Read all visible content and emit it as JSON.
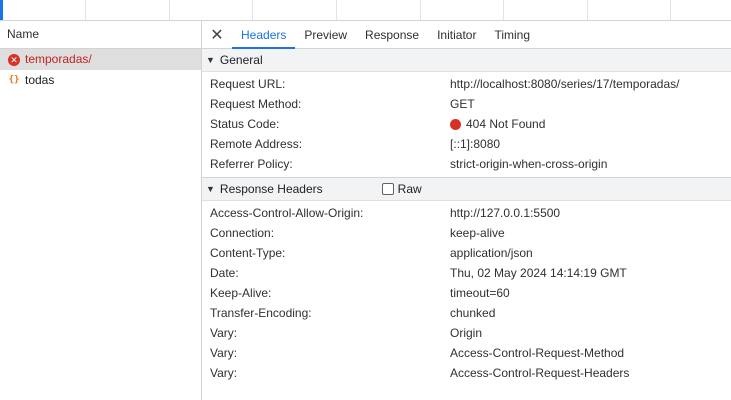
{
  "timeline": {
    "accent_color": "#1a73e8"
  },
  "network": {
    "name_column_label": "Name",
    "requests": [
      {
        "name": "temporadas/",
        "status": "error",
        "icon": "error-circle-icon"
      },
      {
        "name": "todas",
        "status": "ok",
        "icon": "json-braces-icon"
      }
    ]
  },
  "details": {
    "close_label": "✕",
    "tabs": [
      {
        "label": "Headers",
        "active": true
      },
      {
        "label": "Preview",
        "active": false
      },
      {
        "label": "Response",
        "active": false
      },
      {
        "label": "Initiator",
        "active": false
      },
      {
        "label": "Timing",
        "active": false
      }
    ],
    "general": {
      "title": "General",
      "rows": [
        {
          "key": "Request URL:",
          "value": "http://localhost:8080/series/17/temporadas/"
        },
        {
          "key": "Request Method:",
          "value": "GET"
        },
        {
          "key": "Status Code:",
          "value": "404 Not Found",
          "status_color": "#d93025"
        },
        {
          "key": "Remote Address:",
          "value": "[::1]:8080"
        },
        {
          "key": "Referrer Policy:",
          "value": "strict-origin-when-cross-origin"
        }
      ]
    },
    "response_headers": {
      "title": "Response Headers",
      "raw_label": "Raw",
      "raw_checked": false,
      "rows": [
        {
          "key": "Access-Control-Allow-Origin:",
          "value": "http://127.0.0.1:5500"
        },
        {
          "key": "Connection:",
          "value": "keep-alive"
        },
        {
          "key": "Content-Type:",
          "value": "application/json"
        },
        {
          "key": "Date:",
          "value": "Thu, 02 May 2024 14:14:19 GMT"
        },
        {
          "key": "Keep-Alive:",
          "value": "timeout=60"
        },
        {
          "key": "Transfer-Encoding:",
          "value": "chunked"
        },
        {
          "key": "Vary:",
          "value": "Origin"
        },
        {
          "key": "Vary:",
          "value": "Access-Control-Request-Method"
        },
        {
          "key": "Vary:",
          "value": "Access-Control-Request-Headers"
        }
      ]
    }
  }
}
